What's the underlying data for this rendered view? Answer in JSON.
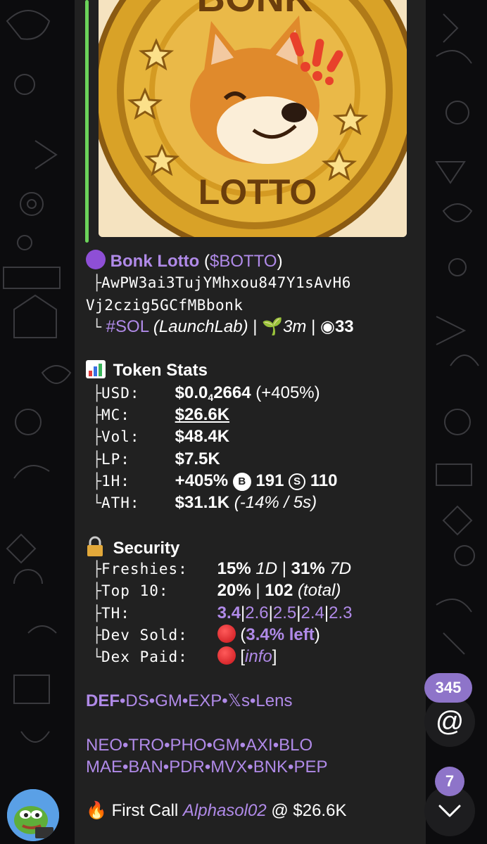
{
  "colors": {
    "background": "#0c0c0e",
    "bubble": "#212121",
    "accent_purple": "#b08ae8",
    "quote_bar_green": "#6bd35a",
    "badge": "#8e74c9"
  },
  "media": {
    "image_text_top": "BONK",
    "image_text_bottom": "LOTTO",
    "image_kind": "bonk-lotto-coin-logo"
  },
  "message": {
    "token_name": "Bonk Lotto",
    "ticker": "$BOTTO",
    "address_line1": "AwPW3ai3TujYMhxou847Y1sAvH6",
    "address_line2": "Vj2czig5GCfMBbonk",
    "chain": "#SOL",
    "platform": "(LaunchLab)",
    "age": "3m",
    "views": "33",
    "stats_title": "Token Stats",
    "stats": {
      "usd_label": "USD:",
      "usd_value_prefix": "$0.0",
      "usd_value_sub": "4",
      "usd_value_rest": "2664",
      "usd_change": "(+405%)",
      "mc_label": "MC:",
      "mc_value": "$26.6K",
      "vol_label": "Vol:",
      "vol_value": "$48.4K",
      "lp_label": "LP:",
      "lp_value": "$7.5K",
      "h1_label": "1H:",
      "h1_value": "+405%",
      "h1_buys_icon": "B",
      "h1_buys": "191",
      "h1_sells_icon": "S",
      "h1_sells": "110",
      "ath_label": "ATH:",
      "ath_value": "$31.1K",
      "ath_change": "(-14% / 5s)"
    },
    "security_title": "Security",
    "security": {
      "freshies_label": "Freshies:",
      "freshies_1d_pct": "15%",
      "freshies_1d": "1D",
      "freshies_7d_pct": "31%",
      "freshies_7d": "7D",
      "top10_label": "Top 10:",
      "top10_pct": "20%",
      "top10_count": "102",
      "top10_total": "(total)",
      "th_label": "TH:",
      "th_values": [
        "3.4",
        "2.6",
        "2.5",
        "2.4",
        "2.3"
      ],
      "devsold_label": "Dev Sold:",
      "devsold_left": "3.4% left",
      "dexpaid_label": "Dex Paid:",
      "dexpaid_info": "info"
    },
    "links_row1": [
      "DEF",
      "DS",
      "GM",
      "EXP",
      "𝕏s",
      "Lens"
    ],
    "links_row2": [
      "NEO",
      "TRO",
      "PHO",
      "GM",
      "AXI",
      "BLO"
    ],
    "links_row3": [
      "MAE",
      "BAN",
      "PDR",
      "MVX",
      "BNK",
      "PEP"
    ],
    "first_call_label": "First Call",
    "first_call_user": "Alphasol02",
    "first_call_at": "@",
    "first_call_mc": "$26.6K"
  },
  "side": {
    "mentions_count": "345",
    "mention_icon": "@",
    "unread_count": "7"
  }
}
